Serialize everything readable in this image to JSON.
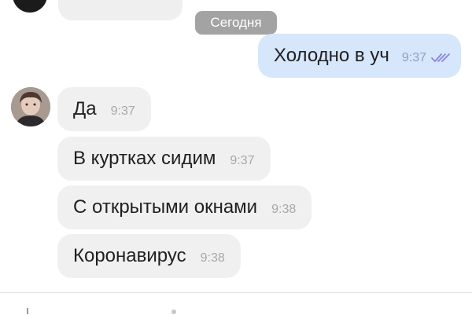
{
  "date_separator": "Сегодня",
  "outgoing": [
    {
      "text": "Холодно в уч",
      "time": "9:37",
      "status": "read",
      "status_icon": "double-check-icon"
    }
  ],
  "incoming": [
    {
      "text": "Да",
      "time": "9:37"
    },
    {
      "text": "В куртках сидим",
      "time": "9:37"
    },
    {
      "text": "С открытыми окнами",
      "time": "9:38"
    },
    {
      "text": "Коронавирус",
      "time": "9:38"
    }
  ],
  "colors": {
    "outgoing_bubble": "#d6e6fb",
    "incoming_bubble": "#f0f0f0",
    "date_chip": "#a3a3a3",
    "read_checks": "#8a85d8"
  }
}
